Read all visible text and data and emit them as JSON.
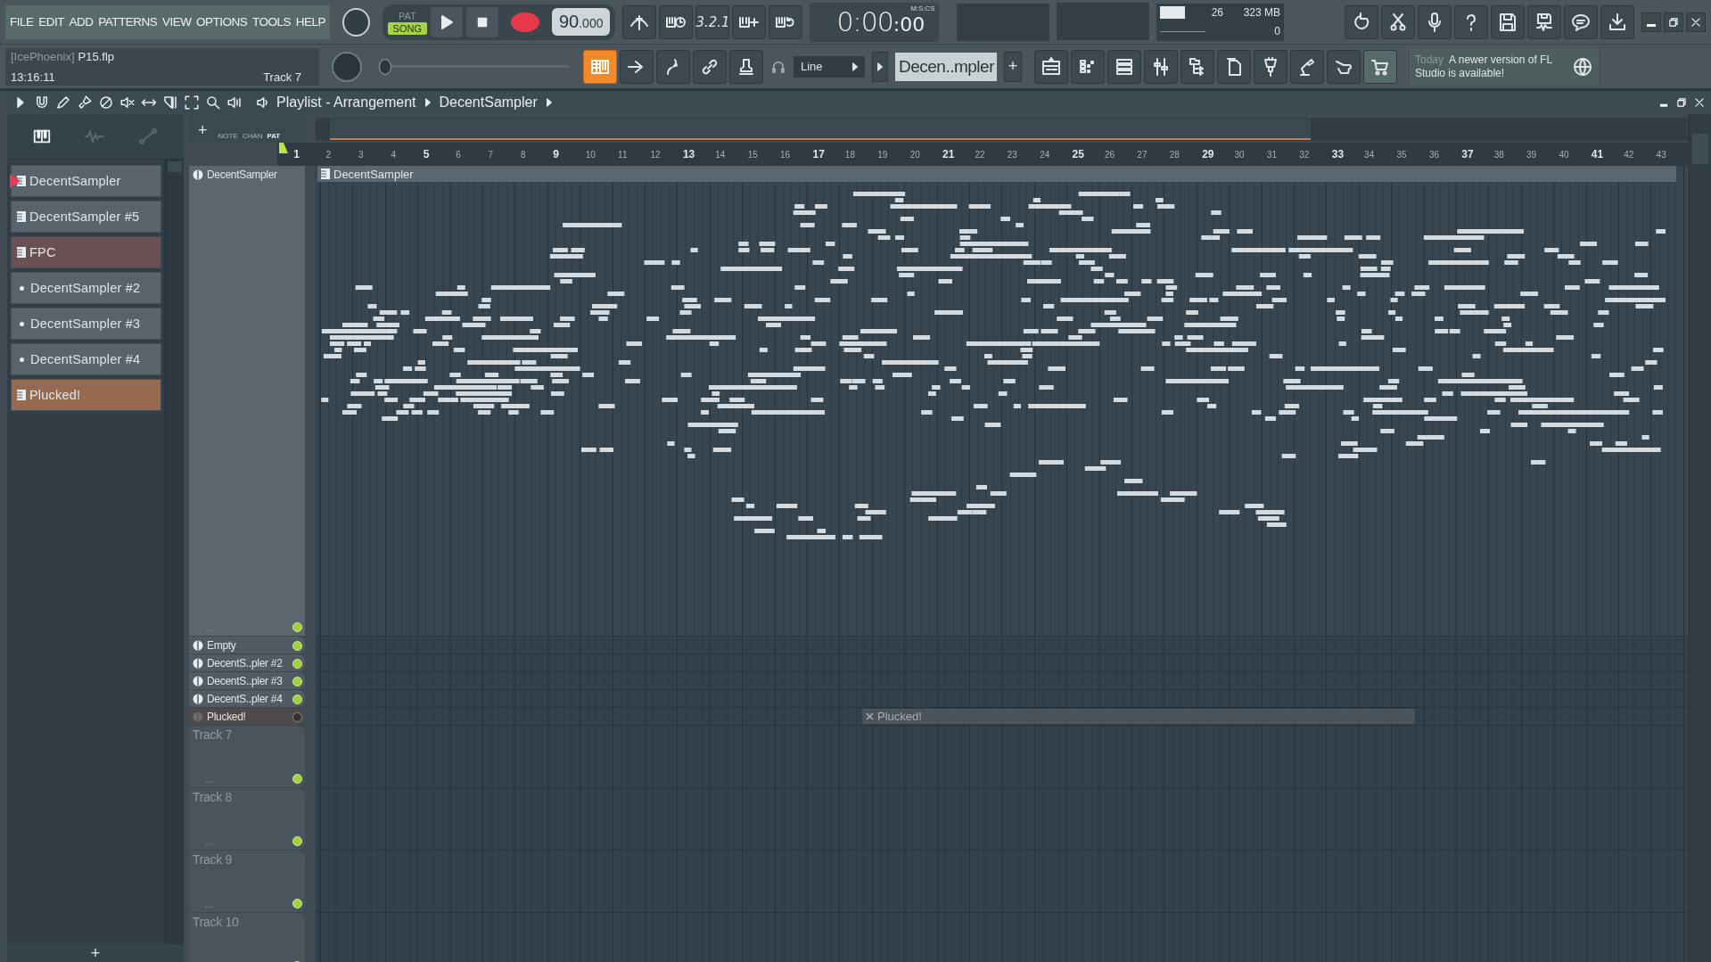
{
  "menu": [
    "FILE",
    "EDIT",
    "ADD",
    "PATTERNS",
    "VIEW",
    "OPTIONS",
    "TOOLS",
    "HELP"
  ],
  "project": {
    "user": "[IcePhoenix]",
    "file": "P15.flp",
    "time": "13:16:11",
    "hint": "Track 7"
  },
  "transport": {
    "modes": [
      {
        "label": "PAT",
        "selected": false
      },
      {
        "label": "SONG",
        "selected": true
      }
    ],
    "tempo": "90",
    "tempo_fraction": ".000",
    "countdown": "3.2.1"
  },
  "clock": {
    "main": "0:00",
    "centis": ":00",
    "unit": "M:S:CS"
  },
  "meters": {
    "cpu": "26",
    "memory": "323 MB",
    "polyphony": "0"
  },
  "pitch_slider": {
    "level": 0.02
  },
  "piano_mode": {
    "on": true
  },
  "snap": {
    "value": "Line"
  },
  "pattern_picker": {
    "value": "Decen..mpler",
    "add": "+"
  },
  "news": {
    "when": "Today",
    "message": "A newer version of FL Studio is available!"
  },
  "playlist": {
    "title": "Playlist - Arrangement",
    "pattern": "DecentSampler",
    "browser_tabs": [
      {
        "label": "NOTE",
        "selected": false
      },
      {
        "label": "CHAN",
        "selected": false
      },
      {
        "label": "PAT",
        "selected": true
      }
    ],
    "add_track": "+",
    "patterns": [
      {
        "name": "DecentSampler",
        "kind": "pattern",
        "color": "#58636b",
        "selected": true
      },
      {
        "name": "DecentSampler #5",
        "kind": "pattern",
        "color": "#58636b",
        "selected": false
      },
      {
        "name": "FPC",
        "kind": "pattern",
        "color": "#6a4f53",
        "selected": false
      },
      {
        "name": "DecentSampler #2",
        "kind": "dot",
        "color": "#58636b",
        "selected": false
      },
      {
        "name": "DecentSampler #3",
        "kind": "dot",
        "color": "#58636b",
        "selected": false
      },
      {
        "name": "DecentSampler #4",
        "kind": "dot",
        "color": "#58636b",
        "selected": false
      },
      {
        "name": "Plucked!",
        "kind": "pattern",
        "color": "#976a4f",
        "selected": false
      }
    ],
    "add_pattern": "+",
    "bars": [
      "1",
      "2",
      "3",
      "4",
      "5",
      "6",
      "7",
      "8",
      "9",
      "10",
      "11",
      "12",
      "13",
      "14",
      "15",
      "16",
      "17",
      "18",
      "19",
      "20",
      "21",
      "22",
      "23",
      "24",
      "25",
      "26",
      "27",
      "28",
      "29",
      "30",
      "31",
      "32",
      "33",
      "34",
      "35",
      "36",
      "37",
      "38",
      "39",
      "40",
      "41",
      "42",
      "43"
    ],
    "tracks": [
      {
        "name": "DecentSampler",
        "kind": "tall",
        "enabled": true,
        "more": "...",
        "clip": {
          "name": "DecentSampler",
          "muted": false
        }
      },
      {
        "name": "Empty",
        "kind": "compact",
        "enabled": true
      },
      {
        "name": "DecentS..pler #2",
        "kind": "compact",
        "enabled": true
      },
      {
        "name": "DecentS..pler #3",
        "kind": "compact",
        "enabled": true
      },
      {
        "name": "DecentS..pler #4",
        "kind": "compact",
        "enabled": true
      },
      {
        "name": "Plucked!",
        "kind": "compact",
        "enabled": false,
        "clip": {
          "name": "Plucked!",
          "muted": true
        }
      },
      {
        "name": "Track 7",
        "kind": "empty",
        "enabled": true,
        "more": "..."
      },
      {
        "name": "Track 8",
        "kind": "empty",
        "enabled": true,
        "more": "..."
      },
      {
        "name": "Track 9",
        "kind": "empty",
        "enabled": true,
        "more": "..."
      },
      {
        "name": "Track 10",
        "kind": "empty",
        "enabled": true
      }
    ]
  }
}
